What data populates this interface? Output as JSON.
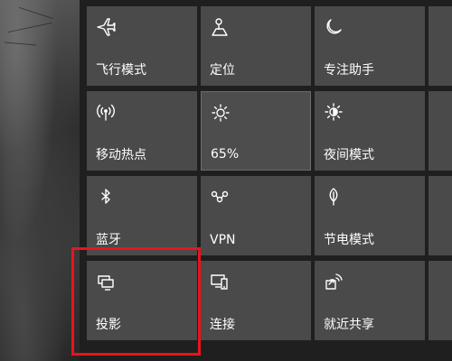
{
  "quick_actions": {
    "tiles": [
      {
        "label": "飞行模式",
        "icon": "airplane-icon"
      },
      {
        "label": "定位",
        "icon": "location-icon"
      },
      {
        "label": "专注助手",
        "icon": "moon-icon"
      },
      {
        "label": "移动热点",
        "icon": "hotspot-icon"
      },
      {
        "label": "65%",
        "icon": "brightness-icon"
      },
      {
        "label": "夜间模式",
        "icon": "night-light-icon"
      },
      {
        "label": "蓝牙",
        "icon": "bluetooth-icon"
      },
      {
        "label": "VPN",
        "icon": "vpn-icon"
      },
      {
        "label": "节电模式",
        "icon": "battery-saver-icon"
      },
      {
        "label": "投影",
        "icon": "project-icon"
      },
      {
        "label": "连接",
        "icon": "connect-icon"
      },
      {
        "label": "就近共享",
        "icon": "nearby-share-icon"
      }
    ]
  },
  "colors": {
    "tile": "#4a4a4a",
    "panel": "#1f1f1f",
    "highlight": "#e8141c",
    "text": "#ffffff"
  }
}
